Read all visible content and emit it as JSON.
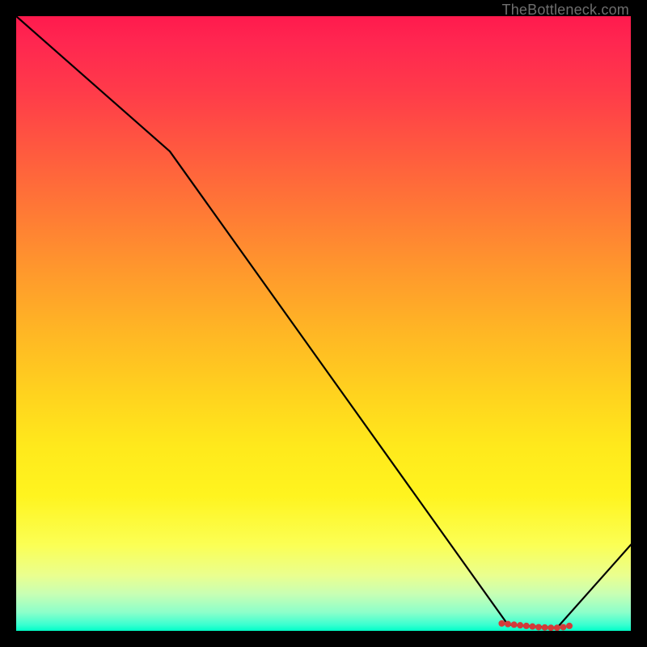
{
  "watermark": "TheBottleneck.com",
  "chart_data": {
    "type": "line",
    "title": "",
    "xlabel": "",
    "ylabel": "",
    "xlim": [
      0,
      100
    ],
    "ylim": [
      0,
      100
    ],
    "grid": false,
    "series": [
      {
        "name": "curve",
        "x": [
          0,
          25,
          80,
          88,
          100
        ],
        "values": [
          100,
          78,
          1,
          0.5,
          14
        ]
      }
    ],
    "markers": {
      "name": "points",
      "x": [
        79,
        80,
        81,
        82,
        83,
        84,
        85,
        86,
        87,
        88,
        89,
        90
      ],
      "values": [
        1.2,
        1.1,
        1.0,
        0.9,
        0.8,
        0.7,
        0.6,
        0.55,
        0.5,
        0.5,
        0.6,
        0.8
      ],
      "color": "#d33a3a",
      "radius": 4
    }
  }
}
